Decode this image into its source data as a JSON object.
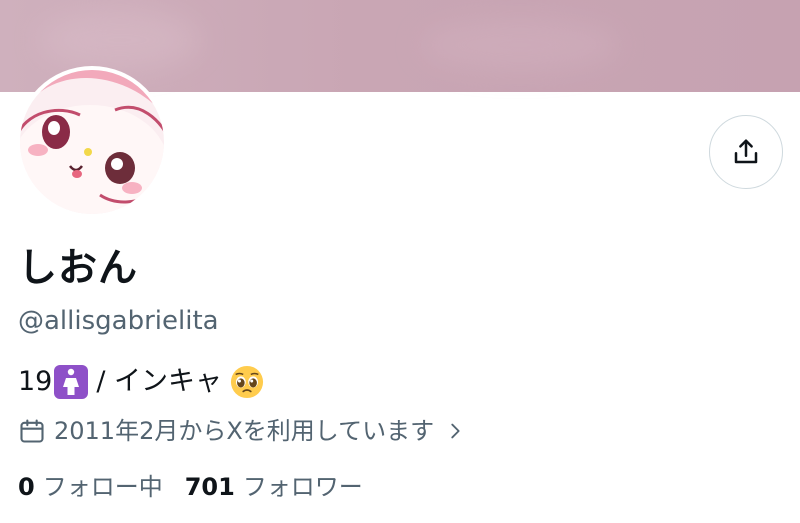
{
  "profile": {
    "display_name": "しおん",
    "handle": "@allisgabrielita",
    "bio_prefix": "19",
    "bio_text": " / インキャ",
    "joined": "2011年2月からXを利用しています",
    "following_count": "0",
    "following_label": "フォロー中",
    "followers_count": "701",
    "followers_label": "フォロワー"
  },
  "icons": {
    "share": "share-icon",
    "calendar": "calendar-icon",
    "chevron": "chevron-right-icon",
    "female_sign": "female-sign-icon",
    "pleading_face": "pleading-face-emoji"
  },
  "colors": {
    "banner": "#c9a6b4",
    "secondary_text": "#536471",
    "primary_text": "#0f1419",
    "border": "#cfd9de",
    "badge": "#8e50c8"
  }
}
